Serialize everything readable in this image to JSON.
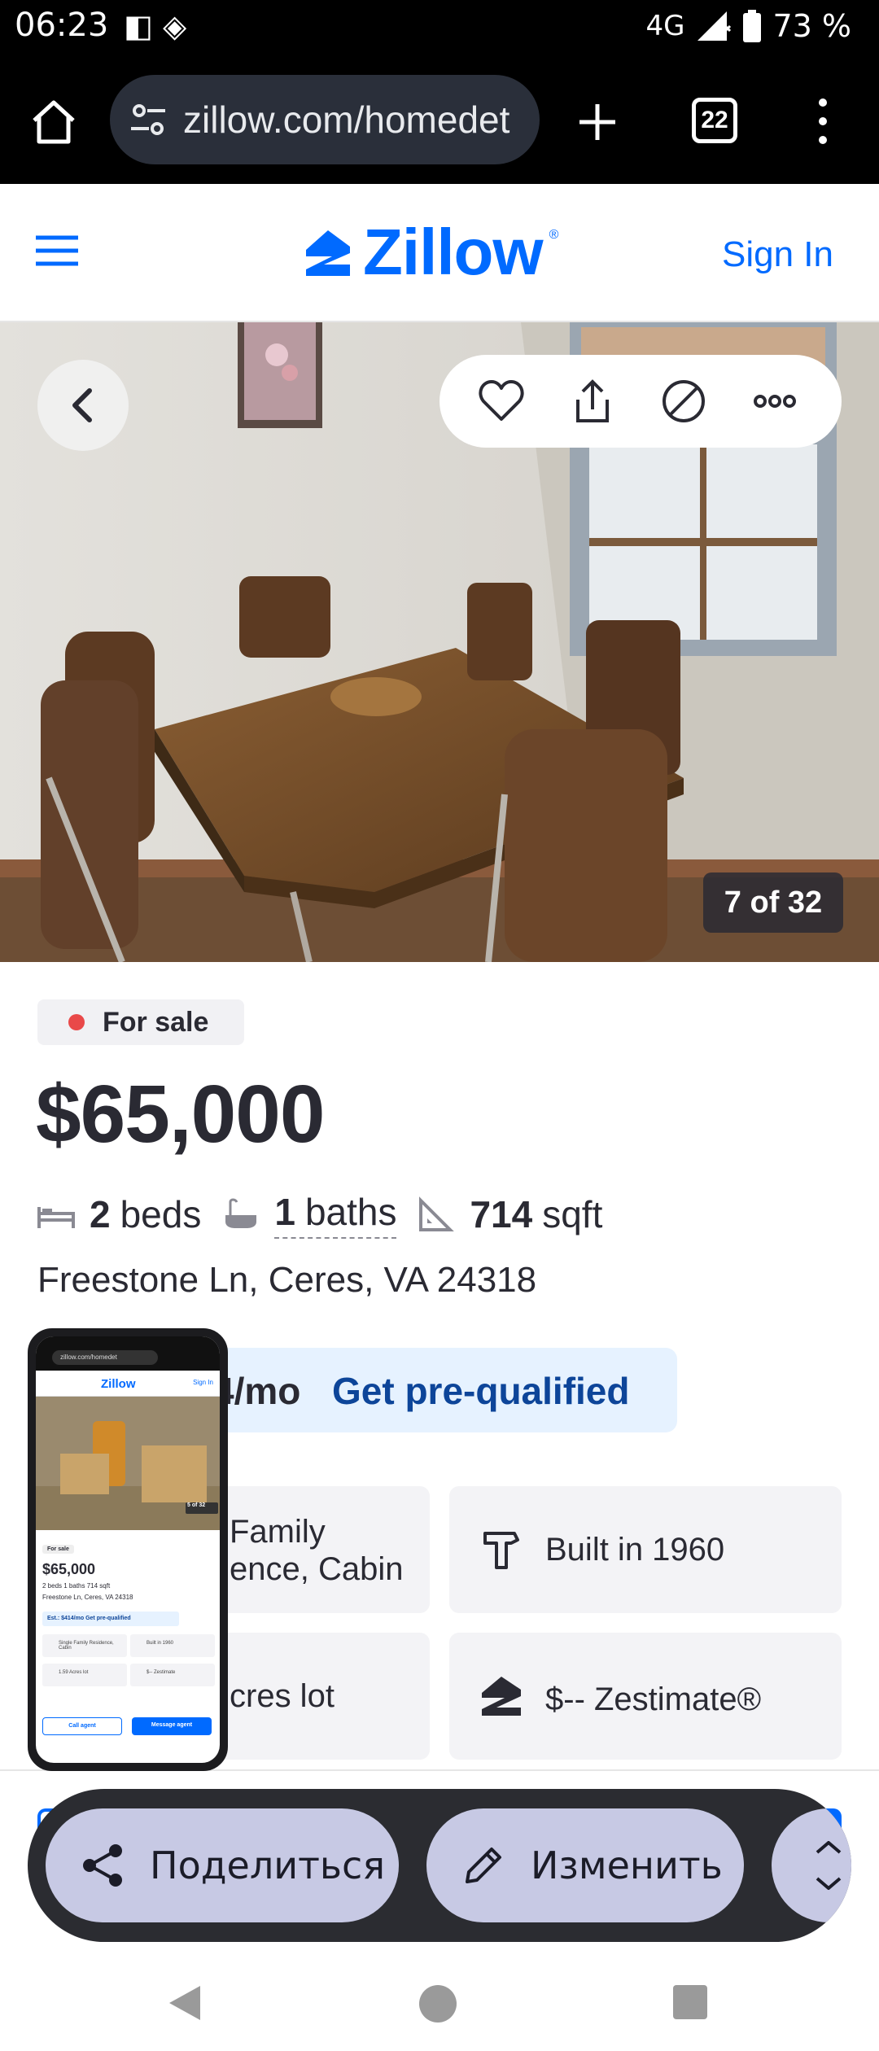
{
  "status_bar": {
    "time": "06:23",
    "left_icons": "◧ ◈",
    "network": "4G",
    "battery": "73 %"
  },
  "browser": {
    "url": "zillow.com/homedet",
    "tab_count": "22"
  },
  "header": {
    "logo_text": "Zillow",
    "sign_in": "Sign In"
  },
  "gallery": {
    "counter": "7 of 32"
  },
  "listing": {
    "status": "For sale",
    "price": "$65,000",
    "beds_value": "2",
    "beds_label": "beds",
    "baths_value": "1",
    "baths_label": "baths",
    "sqft_value": "714",
    "sqft_label": "sqft",
    "address": "Freestone Ln, Ceres, VA 24318",
    "estimate_amount": "4/mo",
    "estimate_cta": "Get pre-qualified",
    "facts": [
      {
        "line1": "Family",
        "line2": "ence, Cabin"
      },
      {
        "line1": "Built in 1960"
      },
      {
        "line1": "cres lot"
      },
      {
        "line1": "$-- Zestimate®"
      }
    ]
  },
  "preview": {
    "url": "zillow.com/homedet",
    "logo": "Zillow",
    "sign_in": "Sign In",
    "status": "For sale",
    "counter": "5 of 32",
    "price": "$65,000",
    "facts": "2 beds  1 baths  714 sqft",
    "address": "Freestone Ln, Ceres, VA 24318",
    "estimate": "Est.: $414/mo  Get pre-qualified",
    "card1": "Single Family Residence, Cabin",
    "card2": "Built in 1960",
    "card3": "1.59 Acres lot",
    "card4": "$-- Zestimate",
    "call_agent": "Call agent",
    "message_agent": "Message agent"
  },
  "share_sheet": {
    "share_label": "Поделиться",
    "edit_label": "Изменить"
  },
  "colors": {
    "brand_blue": "#006aff",
    "sale_dot": "#e94949",
    "chip_bg": "#c7c9e4",
    "pill_bg": "#2b2c31"
  }
}
